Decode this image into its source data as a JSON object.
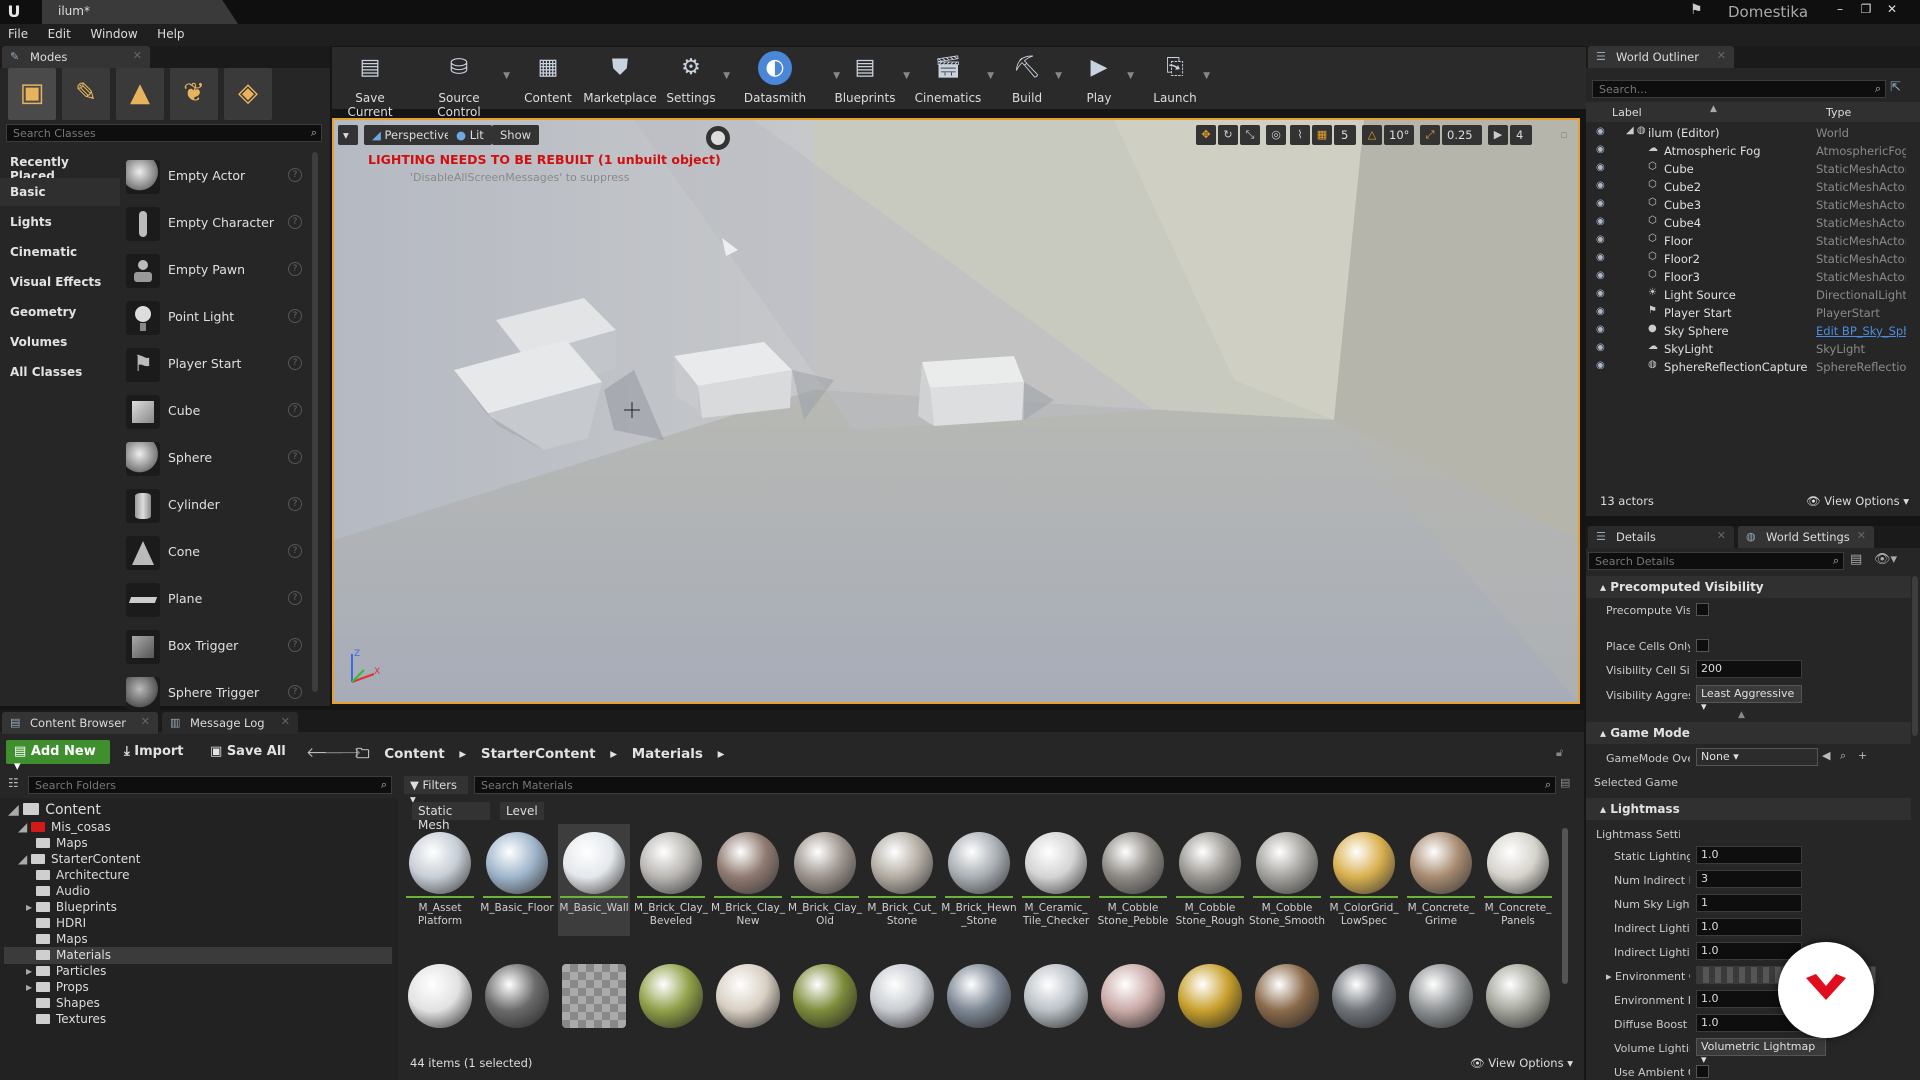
{
  "app": {
    "map_tab": "ilum*",
    "brand": "Domestika"
  },
  "menu": [
    "File",
    "Edit",
    "Window",
    "Help"
  ],
  "modes": {
    "tab": "Modes",
    "search_placeholder": "Search Classes",
    "categories": [
      "Recently Placed",
      "Basic",
      "Lights",
      "Cinematic",
      "Visual Effects",
      "Geometry",
      "Volumes",
      "All Classes"
    ],
    "items": [
      "Empty Actor",
      "Empty Character",
      "Empty Pawn",
      "Point Light",
      "Player Start",
      "Cube",
      "Sphere",
      "Cylinder",
      "Cone",
      "Plane",
      "Box Trigger",
      "Sphere Trigger"
    ]
  },
  "toolbar": [
    "Save Current",
    "Source Control",
    "Content",
    "Marketplace",
    "Settings",
    "Datasmith",
    "Blueprints",
    "Cinematics",
    "Build",
    "Play",
    "Launch"
  ],
  "viewport": {
    "perspective": "Perspective",
    "lit": "Lit",
    "show": "Show",
    "warning": "LIGHTING NEEDS TO BE REBUILT (1 unbuilt object)",
    "suppress": "'DisableAllScreenMessages' to suppress",
    "grid_snap": "5",
    "rot_snap": "10°",
    "scale_snap": "0.25",
    "cam_speed": "4"
  },
  "outliner": {
    "tab": "World Outliner",
    "search_placeholder": "Search...",
    "col_label": "Label",
    "col_type": "Type",
    "rows": [
      {
        "name": "ilum (Editor)",
        "type": "World"
      },
      {
        "name": "Atmospheric Fog",
        "type": "AtmosphericFog"
      },
      {
        "name": "Cube",
        "type": "StaticMeshActor"
      },
      {
        "name": "Cube2",
        "type": "StaticMeshActor"
      },
      {
        "name": "Cube3",
        "type": "StaticMeshActor"
      },
      {
        "name": "Cube4",
        "type": "StaticMeshActor"
      },
      {
        "name": "Floor",
        "type": "StaticMeshActor"
      },
      {
        "name": "Floor2",
        "type": "StaticMeshActor"
      },
      {
        "name": "Floor3",
        "type": "StaticMeshActor"
      },
      {
        "name": "Light Source",
        "type": "DirectionalLight"
      },
      {
        "name": "Player Start",
        "type": "PlayerStart"
      },
      {
        "name": "Sky Sphere",
        "type": "Edit BP_Sky_Sphere"
      },
      {
        "name": "SkyLight",
        "type": "SkyLight"
      },
      {
        "name": "SphereReflectionCapture",
        "type": "SphereReflectionCapture"
      }
    ],
    "count": "13 actors",
    "view_options": "View Options"
  },
  "details": {
    "tab_details": "Details",
    "tab_world": "World Settings",
    "search_placeholder": "Search Details",
    "sections": {
      "precomputed": "Precomputed Visibility",
      "game_mode": "Game Mode",
      "lightmass": "Lightmass"
    },
    "props": {
      "precompute_vis": "Precompute Visibil",
      "place_cells": "Place Cells Only Al",
      "cell_size_label": "Visibility Cell Size",
      "cell_size": "200",
      "aggr_label": "Visibility Aggressi",
      "aggr": "Least Aggressive",
      "gm_override_label": "GameMode Overri",
      "gm_override": "None",
      "selected_gm": "Selected GameMc",
      "lm_settings": "Lightmass Setting",
      "static_lighting_label": "Static Lighting Le",
      "static_lighting": "1.0",
      "num_indirect_label": "Num Indirect Lig",
      "num_indirect": "3",
      "num_sky_label": "Num Sky Lightin",
      "num_sky": "1",
      "indirect1_label": "Indirect Lighting",
      "indirect1": "1.0",
      "indirect2_label": "Indirect Lighting",
      "indirect2": "1.0",
      "env_color": "Environment Col",
      "env_int_label": "Environment Inte",
      "env_int": "1.0",
      "diffuse_label": "Diffuse Boost",
      "diffuse": "1.0",
      "vol_label": "Volume Lighting",
      "vol": "Volumetric Lightmap",
      "use_ao": "Use Ambient Occ"
    }
  },
  "content_browser": {
    "tab_cb": "Content Browser",
    "tab_log": "Message Log",
    "add_new": "Add New",
    "import": "Import",
    "save_all": "Save All",
    "path": [
      "Content",
      "StarterContent",
      "Materials"
    ],
    "folder_search": "Search Folders",
    "filters": "Filters",
    "asset_search": "Search Materials",
    "chips": [
      "Static Mesh",
      "Level"
    ],
    "tree": [
      {
        "name": "Content",
        "depth": 0
      },
      {
        "name": "Mis_cosas",
        "depth": 1
      },
      {
        "name": "Maps",
        "depth": 2
      },
      {
        "name": "StarterContent",
        "depth": 1
      },
      {
        "name": "Architecture",
        "depth": 2
      },
      {
        "name": "Audio",
        "depth": 2
      },
      {
        "name": "Blueprints",
        "depth": 2
      },
      {
        "name": "HDRI",
        "depth": 2
      },
      {
        "name": "Maps",
        "depth": 2
      },
      {
        "name": "Materials",
        "depth": 2
      },
      {
        "name": "Particles",
        "depth": 2
      },
      {
        "name": "Props",
        "depth": 2
      },
      {
        "name": "Shapes",
        "depth": 2
      },
      {
        "name": "Textures",
        "depth": 2
      }
    ],
    "assets": [
      {
        "name": "M_Asset Platform",
        "color": "#c7ced6"
      },
      {
        "name": "M_Basic_Floor",
        "color": "#9fb6cc"
      },
      {
        "name": "M_Basic_Wall",
        "color": "#e4e8ec"
      },
      {
        "name": "M_Brick_Clay_ Beveled",
        "color": "#b9b6b2"
      },
      {
        "name": "M_Brick_Clay_ New",
        "color": "#8f7a70"
      },
      {
        "name": "M_Brick_Clay_ Old",
        "color": "#9d948d"
      },
      {
        "name": "M_Brick_Cut_ Stone",
        "color": "#b3aca3"
      },
      {
        "name": "M_Brick_Hewn _Stone",
        "color": "#a9afb5"
      },
      {
        "name": "M_Ceramic_ Tile_Checker",
        "color": "#d4d4d4"
      },
      {
        "name": "M_Cobble Stone_Pebble",
        "color": "#8e8a85"
      },
      {
        "name": "M_Cobble Stone_Rough",
        "color": "#9a9792"
      },
      {
        "name": "M_Cobble Stone_Smooth",
        "color": "#a4a29d"
      },
      {
        "name": "M_ColorGrid_ LowSpec",
        "color": "#d9b04f"
      },
      {
        "name": "M_Concrete_ Grime",
        "color": "#a88b70"
      },
      {
        "name": "M_Concrete_ Panels",
        "color": "#d6d3cc"
      }
    ],
    "assets_row2": [
      "#e2e2e2",
      "#6a6a6a",
      "#8a8a8a",
      "#8fa048",
      "#d8cfc1",
      "#7d8c3a",
      "#c7ccd1",
      "#7d8794",
      "#b9c0c6",
      "#c9a9a6",
      "#c8a02c",
      "#8a6a4a",
      "#6f747a",
      "#8e9294",
      "#a4a69c"
    ],
    "count": "44 items (1 selected)",
    "view_options": "View Options"
  }
}
